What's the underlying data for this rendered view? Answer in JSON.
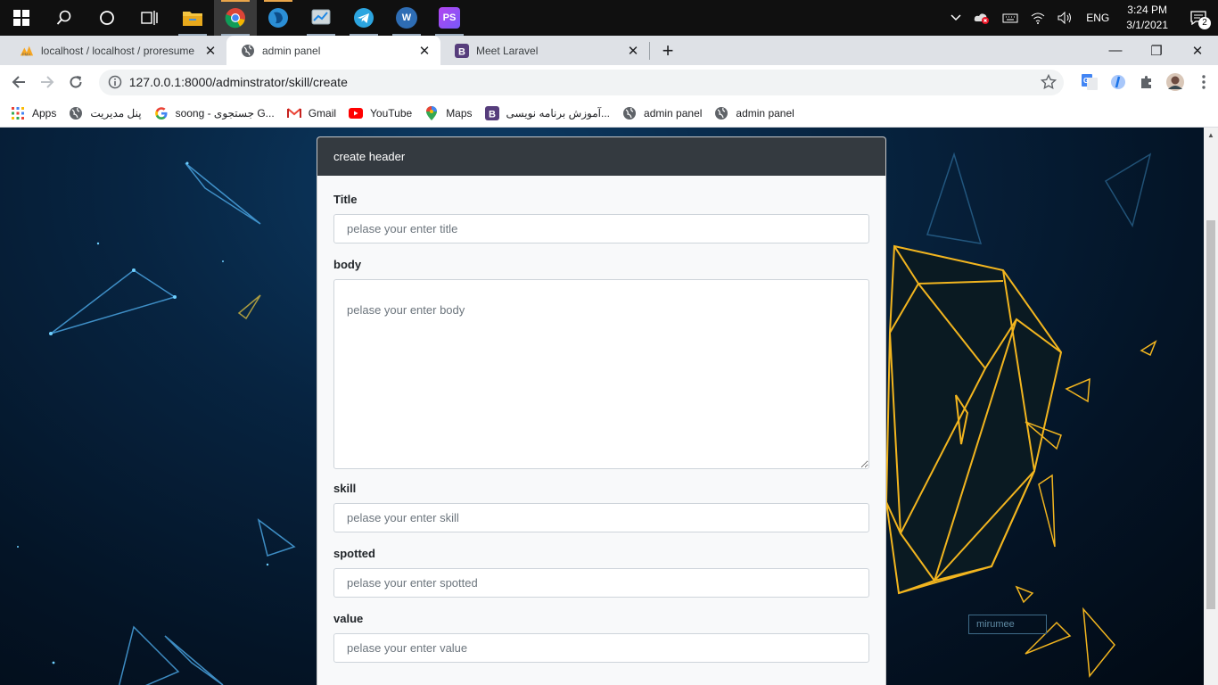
{
  "taskbar": {
    "apps": [
      {
        "name": "file-explorer-icon"
      },
      {
        "name": "chrome-icon"
      },
      {
        "name": "app-blue-icon"
      },
      {
        "name": "app-gray-icon"
      },
      {
        "name": "telegram-icon"
      },
      {
        "name": "wamp-icon",
        "letter": "W"
      },
      {
        "name": "phpstorm-icon",
        "letter": "PS"
      }
    ],
    "tray": {
      "language": "ENG",
      "time": "3:24 PM",
      "date": "3/1/2021",
      "notifications": "2"
    }
  },
  "browser": {
    "tabs": [
      {
        "title": "localhost / localhost / proresume",
        "active": false
      },
      {
        "title": "admin panel",
        "active": true
      },
      {
        "title": "Meet Laravel",
        "active": false
      }
    ],
    "url": "127.0.0.1:8000/adminstrator/skill/create",
    "bookmarks": [
      {
        "label": "Apps"
      },
      {
        "label": "پنل مدیریت"
      },
      {
        "label": "soong - جستجوی G..."
      },
      {
        "label": "Gmail"
      },
      {
        "label": "YouTube"
      },
      {
        "label": "Maps"
      },
      {
        "label": "آموزش برنامه نویسی..."
      },
      {
        "label": "admin panel"
      },
      {
        "label": "admin panel"
      }
    ]
  },
  "form": {
    "header": "create header",
    "fields": {
      "title": {
        "label": "Title",
        "placeholder": "pelase your enter title"
      },
      "body": {
        "label": "body",
        "placeholder": "pelase your enter body"
      },
      "skill": {
        "label": "skill",
        "placeholder": "pelase your enter skill"
      },
      "spotted": {
        "label": "spotted",
        "placeholder": "pelase your enter spotted"
      },
      "value": {
        "label": "value",
        "placeholder": "pelase your enter value"
      }
    }
  },
  "background": {
    "watermark": "mirumee"
  },
  "colors": {
    "card_header": "#343a40",
    "crystal": "#f2b51f",
    "page_background": "#072441"
  }
}
